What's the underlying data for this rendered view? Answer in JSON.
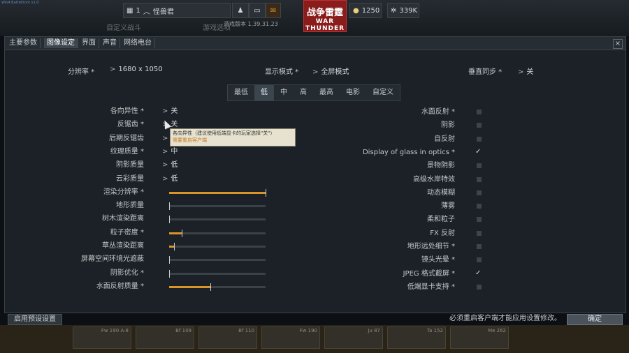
{
  "topbar": {
    "corner_text": "Win4 Battlefront v1.0",
    "player_rank": "1",
    "player_name": "怪兽君",
    "game_version": "游戏版本 1.39.31.23",
    "logo_cn": "战争雷霆",
    "logo_en": "WAR THUNDER",
    "silver_lions": "1250",
    "golden_eagles": "339K",
    "bg_menu_1": "自定义战斗",
    "bg_menu_2": "游戏选项"
  },
  "tabs": [
    {
      "label": "主要参数",
      "active": false
    },
    {
      "label": "图像设定",
      "active": true
    },
    {
      "label": "界面",
      "active": false
    },
    {
      "label": "声音",
      "active": false
    },
    {
      "label": "网络电台",
      "active": false
    }
  ],
  "close_label": "×",
  "top_settings": {
    "resolution_label": "分辨率 *",
    "resolution_value": "1680 x 1050",
    "display_mode_label": "显示模式 *",
    "display_mode_value": "全屏模式",
    "vsync_label": "垂直同步 *",
    "vsync_value": "关"
  },
  "presets": [
    {
      "label": "最低",
      "active": false
    },
    {
      "label": "低",
      "active": true
    },
    {
      "label": "中",
      "active": false
    },
    {
      "label": "高",
      "active": false
    },
    {
      "label": "最高",
      "active": false
    },
    {
      "label": "电影",
      "active": false
    },
    {
      "label": "自定义",
      "active": false
    }
  ],
  "left_settings": [
    {
      "label": "各向异性 *",
      "kind": "select",
      "value": "关"
    },
    {
      "label": "反锯齿 *",
      "kind": "select",
      "value": "关"
    },
    {
      "label": "后期反锯齿",
      "kind": "select",
      "value": ""
    },
    {
      "label": "纹理质量 *",
      "kind": "select",
      "value": "中"
    },
    {
      "label": "阴影质量",
      "kind": "select",
      "value": "低"
    },
    {
      "label": "云彩质量",
      "kind": "select",
      "value": "低"
    },
    {
      "label": "渲染分辨率 *",
      "kind": "slider",
      "value": 1.0
    },
    {
      "label": "地形质量",
      "kind": "slider",
      "value": 0.0
    },
    {
      "label": "树木渲染距离",
      "kind": "slider",
      "value": 0.0
    },
    {
      "label": "粒子密度 *",
      "kind": "slider",
      "value": 0.13
    },
    {
      "label": "草丛渲染距离",
      "kind": "slider",
      "value": 0.05
    },
    {
      "label": "屏幕空间环境光遮蔽",
      "kind": "slider",
      "value": 0.0
    },
    {
      "label": "阴影优化 *",
      "kind": "slider",
      "value": 0.0
    },
    {
      "label": "水面反射质量 *",
      "kind": "slider",
      "value": 0.43
    }
  ],
  "right_settings": [
    {
      "label": "水面反射 *",
      "checked": false
    },
    {
      "label": "阴影",
      "checked": false
    },
    {
      "label": "自反射",
      "checked": false
    },
    {
      "label": "Display of glass in optics *",
      "checked": true
    },
    {
      "label": "景物阴影",
      "checked": false
    },
    {
      "label": "高级水岸特效",
      "checked": false
    },
    {
      "label": "动态模糊",
      "checked": false
    },
    {
      "label": "薄雾",
      "checked": false
    },
    {
      "label": "柔和粒子",
      "checked": false
    },
    {
      "label": "FX 反射",
      "checked": false
    },
    {
      "label": "地形远处细节 *",
      "checked": false
    },
    {
      "label": "镜头光晕 *",
      "checked": false
    },
    {
      "label": "JPEG 格式截屏 *",
      "checked": true
    },
    {
      "label": "低端显卡支持 *",
      "checked": false
    }
  ],
  "tooltip": {
    "line1": "各向异性（建议使用低端显卡的玩家选择\"关\"）",
    "line2": "需要重启客户端"
  },
  "bottom": {
    "reset_label": "启用预设设置",
    "notice": "必须重启客户端才能应用设置修改。",
    "ok_label": "确定"
  },
  "vehicle_slots": [
    "Fw 190 A-8",
    "Bf 109",
    "Bf 110",
    "Fw 190",
    "Ju 87",
    "Ta 152",
    "Me 262"
  ],
  "colors": {
    "slider_fill": "#d9952a",
    "logo_bg": "#8a1c1c",
    "dialog_bg": "#1b2126"
  }
}
